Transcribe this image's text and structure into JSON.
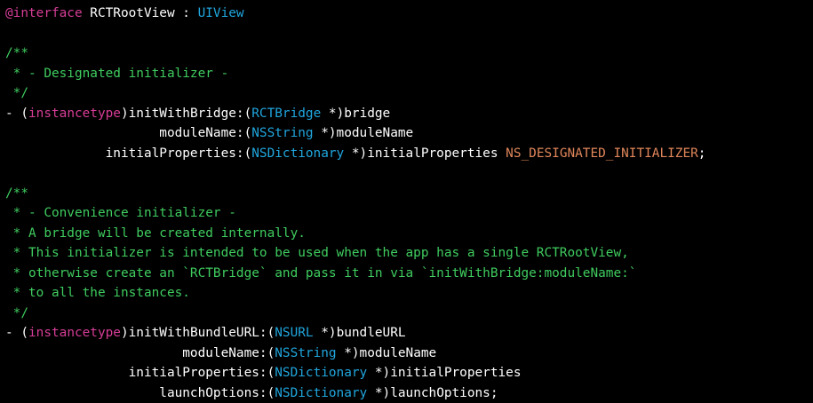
{
  "colors": {
    "background": "#000000",
    "plain": "#ffffff",
    "keyword": "#d63d96",
    "type": "#20a6de",
    "comment": "#3fcc5f",
    "macro": "#e0865a"
  },
  "code": {
    "lines": [
      [
        [
          "keyword",
          "@interface"
        ],
        [
          "plain",
          " RCTRootView : "
        ],
        [
          "type",
          "UIView"
        ]
      ],
      [],
      [
        [
          "comment",
          "/**"
        ]
      ],
      [
        [
          "comment",
          " * - Designated initializer -"
        ]
      ],
      [
        [
          "comment",
          " */"
        ]
      ],
      [
        [
          "plain",
          "- ("
        ],
        [
          "keyword",
          "instancetype"
        ],
        [
          "plain",
          ")initWithBridge:("
        ],
        [
          "type",
          "RCTBridge"
        ],
        [
          "plain",
          " *)bridge"
        ]
      ],
      [
        [
          "plain",
          "                    moduleName:("
        ],
        [
          "type",
          "NSString"
        ],
        [
          "plain",
          " *)moduleName"
        ]
      ],
      [
        [
          "plain",
          "             initialProperties:("
        ],
        [
          "type",
          "NSDictionary"
        ],
        [
          "plain",
          " *)initialProperties "
        ],
        [
          "macro",
          "NS_DESIGNATED_INITIALIZER"
        ],
        [
          "plain",
          ";"
        ]
      ],
      [],
      [
        [
          "comment",
          "/**"
        ]
      ],
      [
        [
          "comment",
          " * - Convenience initializer -"
        ]
      ],
      [
        [
          "comment",
          " * A bridge will be created internally."
        ]
      ],
      [
        [
          "comment",
          " * This initializer is intended to be used when the app has a single RCTRootView,"
        ]
      ],
      [
        [
          "comment",
          " * otherwise create an `RCTBridge` and pass it in via `initWithBridge:moduleName:`"
        ]
      ],
      [
        [
          "comment",
          " * to all the instances."
        ]
      ],
      [
        [
          "comment",
          " */"
        ]
      ],
      [
        [
          "plain",
          "- ("
        ],
        [
          "keyword",
          "instancetype"
        ],
        [
          "plain",
          ")initWithBundleURL:("
        ],
        [
          "type",
          "NSURL"
        ],
        [
          "plain",
          " *)bundleURL"
        ]
      ],
      [
        [
          "plain",
          "                       moduleName:("
        ],
        [
          "type",
          "NSString"
        ],
        [
          "plain",
          " *)moduleName"
        ]
      ],
      [
        [
          "plain",
          "                initialProperties:("
        ],
        [
          "type",
          "NSDictionary"
        ],
        [
          "plain",
          " *)initialProperties"
        ]
      ],
      [
        [
          "plain",
          "                    launchOptions:("
        ],
        [
          "type",
          "NSDictionary"
        ],
        [
          "plain",
          " *)launchOptions;"
        ]
      ]
    ]
  }
}
